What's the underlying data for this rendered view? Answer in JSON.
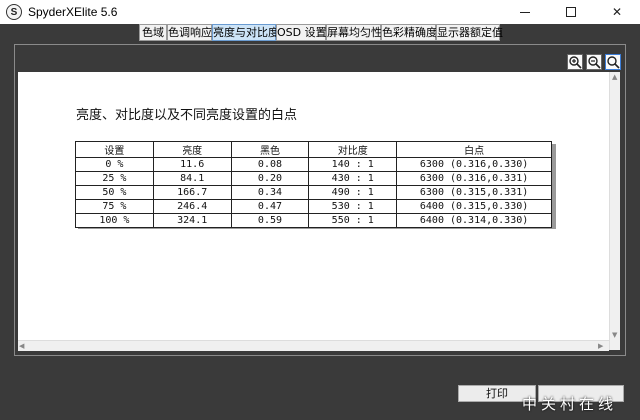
{
  "window": {
    "title": "SpyderXElite 5.6",
    "icon_letter": "S",
    "minimize_icon": "minimize-icon",
    "maximize_icon": "maximize-icon",
    "close_label": "✕"
  },
  "tabs": [
    {
      "label": "色域",
      "active": false
    },
    {
      "label": "色调响应",
      "active": false
    },
    {
      "label": "亮度与对比度",
      "active": true
    },
    {
      "label": "OSD 设置",
      "active": false
    },
    {
      "label": "屏幕均匀性",
      "active": false
    },
    {
      "label": "色彩精确度",
      "active": false
    },
    {
      "label": "显示器额定值",
      "active": false
    }
  ],
  "toolbar": {
    "zoom_in_icon": "zoom-in-icon",
    "zoom_out_icon": "zoom-out-icon",
    "zoom_fit_icon": "zoom-fit-icon"
  },
  "report": {
    "title": "亮度、对比度以及不同亮度设置的白点",
    "table": {
      "headers": [
        "设置",
        "亮度",
        "黑色",
        "对比度",
        "白点"
      ],
      "rows": [
        [
          "0 %",
          "11.6",
          "0.08",
          "140 : 1",
          "6300 (0.316,0.330)"
        ],
        [
          "25 %",
          "84.1",
          "0.20",
          "430 : 1",
          "6300 (0.316,0.331)"
        ],
        [
          "50 %",
          "166.7",
          "0.34",
          "490 : 1",
          "6300 (0.315,0.331)"
        ],
        [
          "75 %",
          "246.4",
          "0.47",
          "530 : 1",
          "6400 (0.315,0.330)"
        ],
        [
          "100 %",
          "324.1",
          "0.59",
          "550 : 1",
          "6400 (0.314,0.330)"
        ]
      ]
    }
  },
  "footer": {
    "print_label": "打印"
  },
  "watermark": "中关村在线",
  "colors": {
    "background": "#3a3a3a",
    "active_tab": "#cde4f7",
    "panel": "#ffffff"
  }
}
